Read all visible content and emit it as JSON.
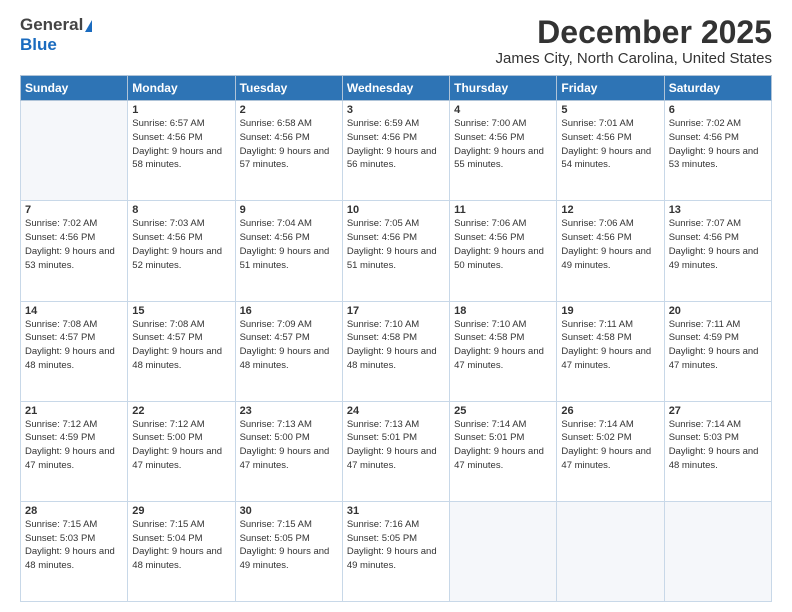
{
  "header": {
    "logo_general": "General",
    "logo_blue": "Blue",
    "main_title": "December 2025",
    "subtitle": "James City, North Carolina, United States"
  },
  "calendar": {
    "days_of_week": [
      "Sunday",
      "Monday",
      "Tuesday",
      "Wednesday",
      "Thursday",
      "Friday",
      "Saturday"
    ],
    "weeks": [
      [
        {
          "day": "",
          "sunrise": "",
          "sunset": "",
          "daylight": ""
        },
        {
          "day": "1",
          "sunrise": "Sunrise: 6:57 AM",
          "sunset": "Sunset: 4:56 PM",
          "daylight": "Daylight: 9 hours and 58 minutes."
        },
        {
          "day": "2",
          "sunrise": "Sunrise: 6:58 AM",
          "sunset": "Sunset: 4:56 PM",
          "daylight": "Daylight: 9 hours and 57 minutes."
        },
        {
          "day": "3",
          "sunrise": "Sunrise: 6:59 AM",
          "sunset": "Sunset: 4:56 PM",
          "daylight": "Daylight: 9 hours and 56 minutes."
        },
        {
          "day": "4",
          "sunrise": "Sunrise: 7:00 AM",
          "sunset": "Sunset: 4:56 PM",
          "daylight": "Daylight: 9 hours and 55 minutes."
        },
        {
          "day": "5",
          "sunrise": "Sunrise: 7:01 AM",
          "sunset": "Sunset: 4:56 PM",
          "daylight": "Daylight: 9 hours and 54 minutes."
        },
        {
          "day": "6",
          "sunrise": "Sunrise: 7:02 AM",
          "sunset": "Sunset: 4:56 PM",
          "daylight": "Daylight: 9 hours and 53 minutes."
        }
      ],
      [
        {
          "day": "7",
          "sunrise": "Sunrise: 7:02 AM",
          "sunset": "Sunset: 4:56 PM",
          "daylight": "Daylight: 9 hours and 53 minutes."
        },
        {
          "day": "8",
          "sunrise": "Sunrise: 7:03 AM",
          "sunset": "Sunset: 4:56 PM",
          "daylight": "Daylight: 9 hours and 52 minutes."
        },
        {
          "day": "9",
          "sunrise": "Sunrise: 7:04 AM",
          "sunset": "Sunset: 4:56 PM",
          "daylight": "Daylight: 9 hours and 51 minutes."
        },
        {
          "day": "10",
          "sunrise": "Sunrise: 7:05 AM",
          "sunset": "Sunset: 4:56 PM",
          "daylight": "Daylight: 9 hours and 51 minutes."
        },
        {
          "day": "11",
          "sunrise": "Sunrise: 7:06 AM",
          "sunset": "Sunset: 4:56 PM",
          "daylight": "Daylight: 9 hours and 50 minutes."
        },
        {
          "day": "12",
          "sunrise": "Sunrise: 7:06 AM",
          "sunset": "Sunset: 4:56 PM",
          "daylight": "Daylight: 9 hours and 49 minutes."
        },
        {
          "day": "13",
          "sunrise": "Sunrise: 7:07 AM",
          "sunset": "Sunset: 4:56 PM",
          "daylight": "Daylight: 9 hours and 49 minutes."
        }
      ],
      [
        {
          "day": "14",
          "sunrise": "Sunrise: 7:08 AM",
          "sunset": "Sunset: 4:57 PM",
          "daylight": "Daylight: 9 hours and 48 minutes."
        },
        {
          "day": "15",
          "sunrise": "Sunrise: 7:08 AM",
          "sunset": "Sunset: 4:57 PM",
          "daylight": "Daylight: 9 hours and 48 minutes."
        },
        {
          "day": "16",
          "sunrise": "Sunrise: 7:09 AM",
          "sunset": "Sunset: 4:57 PM",
          "daylight": "Daylight: 9 hours and 48 minutes."
        },
        {
          "day": "17",
          "sunrise": "Sunrise: 7:10 AM",
          "sunset": "Sunset: 4:58 PM",
          "daylight": "Daylight: 9 hours and 48 minutes."
        },
        {
          "day": "18",
          "sunrise": "Sunrise: 7:10 AM",
          "sunset": "Sunset: 4:58 PM",
          "daylight": "Daylight: 9 hours and 47 minutes."
        },
        {
          "day": "19",
          "sunrise": "Sunrise: 7:11 AM",
          "sunset": "Sunset: 4:58 PM",
          "daylight": "Daylight: 9 hours and 47 minutes."
        },
        {
          "day": "20",
          "sunrise": "Sunrise: 7:11 AM",
          "sunset": "Sunset: 4:59 PM",
          "daylight": "Daylight: 9 hours and 47 minutes."
        }
      ],
      [
        {
          "day": "21",
          "sunrise": "Sunrise: 7:12 AM",
          "sunset": "Sunset: 4:59 PM",
          "daylight": "Daylight: 9 hours and 47 minutes."
        },
        {
          "day": "22",
          "sunrise": "Sunrise: 7:12 AM",
          "sunset": "Sunset: 5:00 PM",
          "daylight": "Daylight: 9 hours and 47 minutes."
        },
        {
          "day": "23",
          "sunrise": "Sunrise: 7:13 AM",
          "sunset": "Sunset: 5:00 PM",
          "daylight": "Daylight: 9 hours and 47 minutes."
        },
        {
          "day": "24",
          "sunrise": "Sunrise: 7:13 AM",
          "sunset": "Sunset: 5:01 PM",
          "daylight": "Daylight: 9 hours and 47 minutes."
        },
        {
          "day": "25",
          "sunrise": "Sunrise: 7:14 AM",
          "sunset": "Sunset: 5:01 PM",
          "daylight": "Daylight: 9 hours and 47 minutes."
        },
        {
          "day": "26",
          "sunrise": "Sunrise: 7:14 AM",
          "sunset": "Sunset: 5:02 PM",
          "daylight": "Daylight: 9 hours and 47 minutes."
        },
        {
          "day": "27",
          "sunrise": "Sunrise: 7:14 AM",
          "sunset": "Sunset: 5:03 PM",
          "daylight": "Daylight: 9 hours and 48 minutes."
        }
      ],
      [
        {
          "day": "28",
          "sunrise": "Sunrise: 7:15 AM",
          "sunset": "Sunset: 5:03 PM",
          "daylight": "Daylight: 9 hours and 48 minutes."
        },
        {
          "day": "29",
          "sunrise": "Sunrise: 7:15 AM",
          "sunset": "Sunset: 5:04 PM",
          "daylight": "Daylight: 9 hours and 48 minutes."
        },
        {
          "day": "30",
          "sunrise": "Sunrise: 7:15 AM",
          "sunset": "Sunset: 5:05 PM",
          "daylight": "Daylight: 9 hours and 49 minutes."
        },
        {
          "day": "31",
          "sunrise": "Sunrise: 7:16 AM",
          "sunset": "Sunset: 5:05 PM",
          "daylight": "Daylight: 9 hours and 49 minutes."
        },
        {
          "day": "",
          "sunrise": "",
          "sunset": "",
          "daylight": ""
        },
        {
          "day": "",
          "sunrise": "",
          "sunset": "",
          "daylight": ""
        },
        {
          "day": "",
          "sunrise": "",
          "sunset": "",
          "daylight": ""
        }
      ]
    ]
  }
}
